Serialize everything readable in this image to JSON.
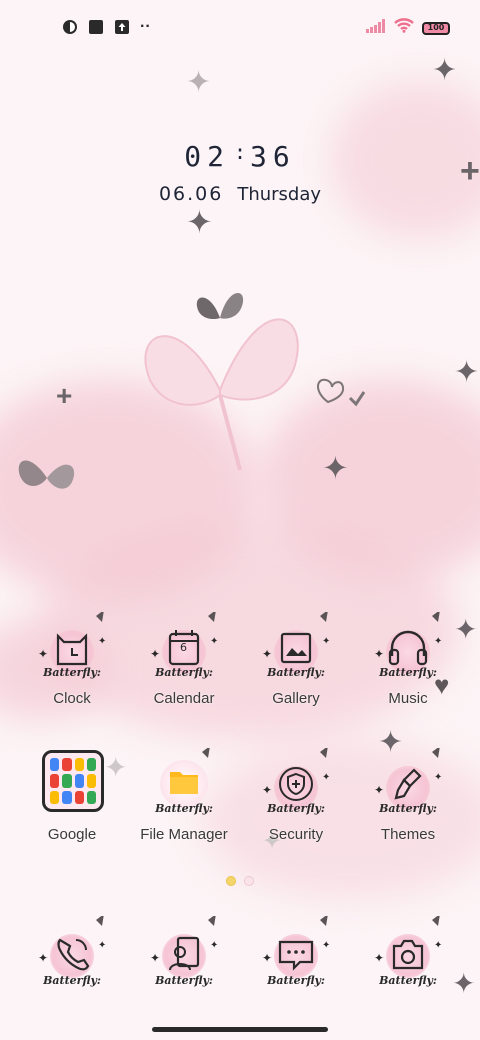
{
  "status_bar": {
    "left_icons": [
      "notification-app-icon",
      "square-app-icon",
      "upload-icon",
      "more-dots-icon"
    ],
    "more_dots": "··",
    "battery_level": "100",
    "colors": {
      "signal": "#ef8aa4",
      "wifi": "#ef6f8f",
      "battery_fill": "#f08aa5"
    }
  },
  "clock_widget": {
    "hour": "02",
    "separator": ":",
    "minute": "36",
    "date": "06.06",
    "weekday": "Thursday"
  },
  "theme": {
    "badge_text": "Batterfly:",
    "accent": "#f4c9d3",
    "line_color": "#2a2a2a"
  },
  "apps_row1": [
    {
      "label": "Clock",
      "icon": "clock-cat-icon"
    },
    {
      "label": "Calendar",
      "icon": "calendar-icon",
      "calendar_day": "6"
    },
    {
      "label": "Gallery",
      "icon": "gallery-icon"
    },
    {
      "label": "Music",
      "icon": "headphones-icon"
    }
  ],
  "apps_row2": [
    {
      "label": "Google",
      "icon": "google-folder-icon"
    },
    {
      "label": "File Manager",
      "icon": "folder-icon"
    },
    {
      "label": "Security",
      "icon": "shield-icon"
    },
    {
      "label": "Themes",
      "icon": "paintbrush-icon"
    }
  ],
  "dock": [
    {
      "icon": "phone-icon"
    },
    {
      "icon": "contacts-icon"
    },
    {
      "icon": "messages-icon"
    },
    {
      "icon": "camera-icon"
    }
  ],
  "page_indicator": {
    "pages": 2,
    "current": 1
  }
}
